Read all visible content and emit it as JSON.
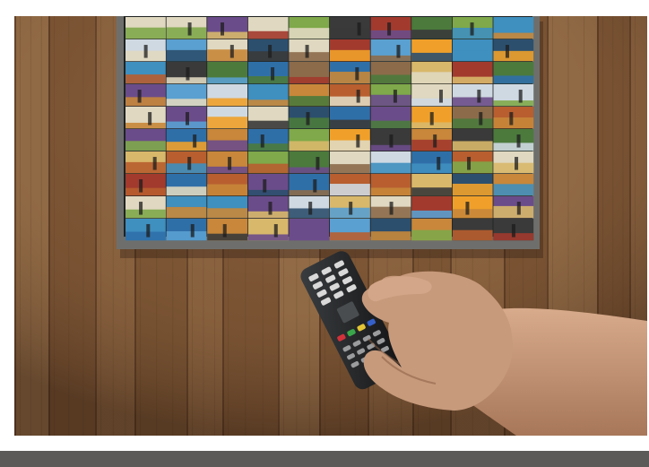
{
  "colors": {
    "page_background": "#ffffff",
    "footer_bar": "#5c5a58",
    "wood_base": "#7a5433",
    "wood_light": "#a87f57",
    "wood_dark": "#4a2f1c",
    "tv_frame": "#6e6f6c",
    "tv_screen": "#1f2222",
    "remote_body": "#202224",
    "remote_button_red": "#d2323a",
    "remote_button_green": "#3aa64a",
    "remote_button_yellow": "#e3c435",
    "remote_button_blue": "#3560c8",
    "skin": "#c79a7c"
  },
  "thumbnail_palette": [
    "#2f6fa8",
    "#c8873a",
    "#4b7a3c",
    "#a23a2e",
    "#d8b86a",
    "#3f8fbf",
    "#6b4c8a",
    "#e0d8c0",
    "#7fa94a",
    "#b85e2f",
    "#2c4f6e",
    "#f0a02a",
    "#5aa0d0",
    "#8c6b4a",
    "#cfd9e2",
    "#3a3a3a"
  ]
}
